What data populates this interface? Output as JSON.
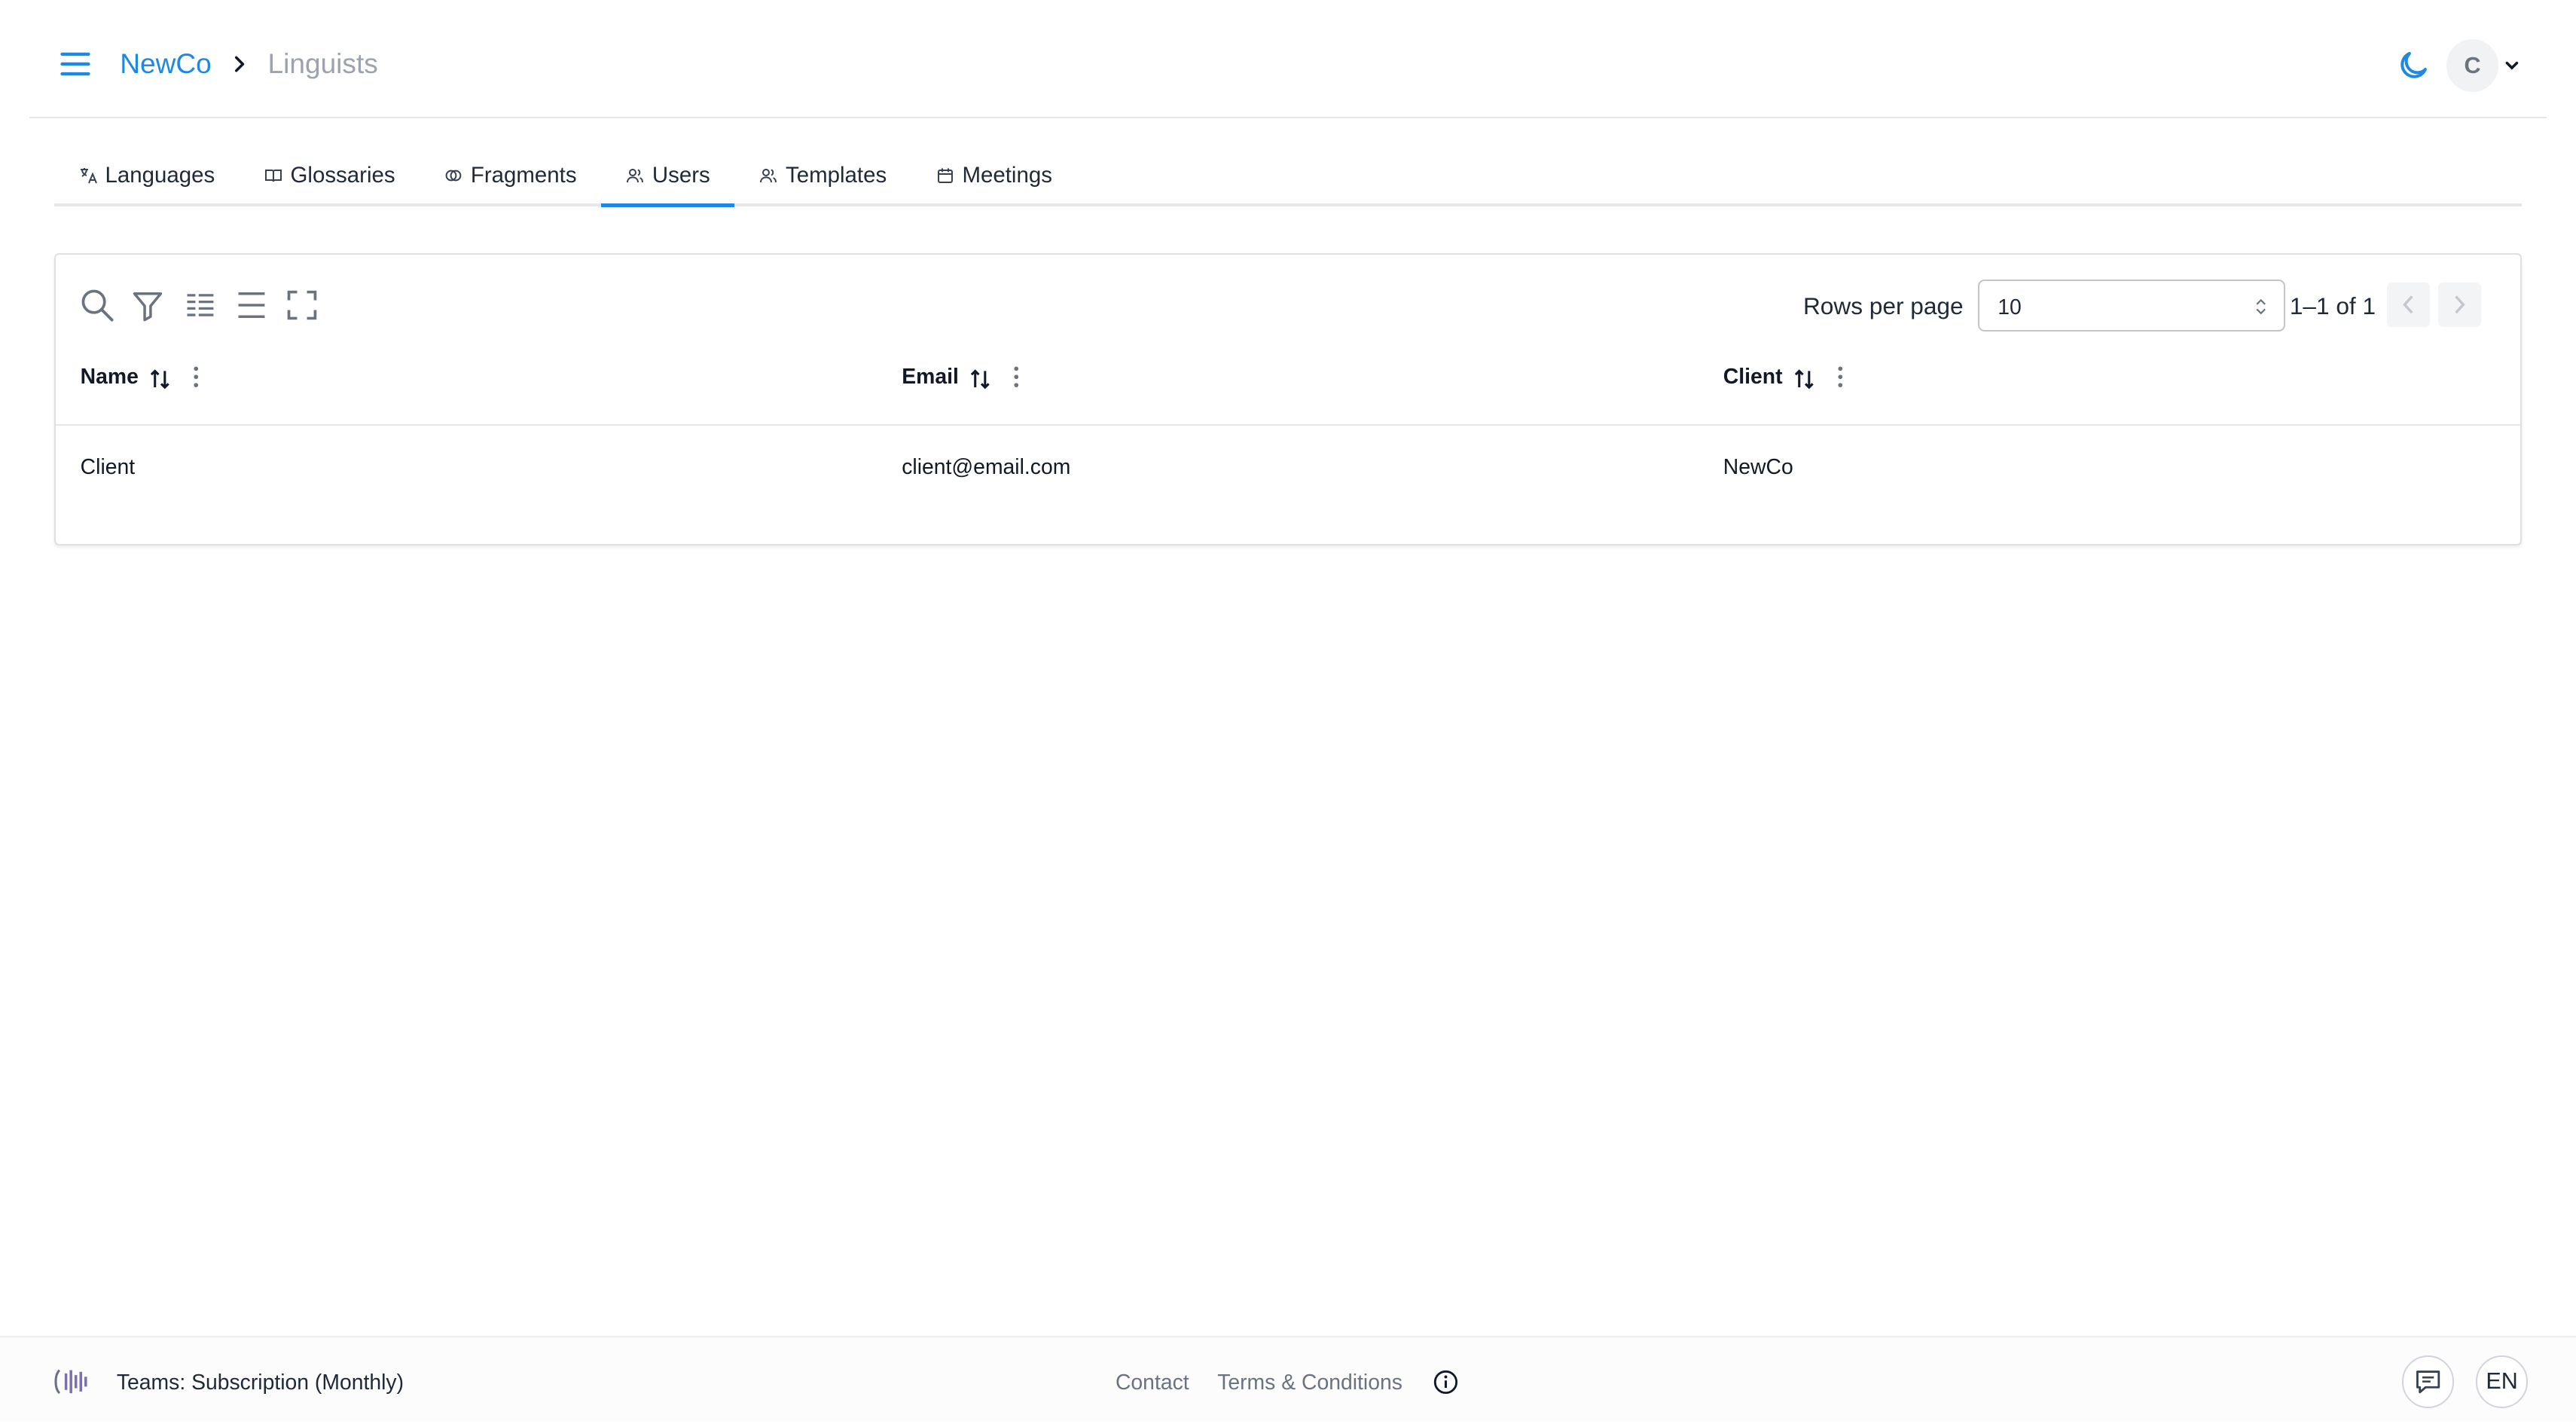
{
  "header": {
    "breadcrumb_home": "NewCo",
    "breadcrumb_current": "Linguists",
    "avatar_initial": "C",
    "accent_color": "#1e88e5"
  },
  "tabs": [
    {
      "label": "Languages",
      "icon": "translate-icon"
    },
    {
      "label": "Glossaries",
      "icon": "book-icon"
    },
    {
      "label": "Fragments",
      "icon": "fragments-icon"
    },
    {
      "label": "Users",
      "icon": "users-icon",
      "active": true
    },
    {
      "label": "Templates",
      "icon": "users-icon"
    },
    {
      "label": "Meetings",
      "icon": "calendar-icon"
    }
  ],
  "table": {
    "toolbar_icons": [
      "search-icon",
      "filter-icon",
      "columns-icon",
      "density-icon",
      "fullscreen-icon"
    ],
    "rows_per_page_label": "Rows per page",
    "rows_per_page_value": "10",
    "range_text": "1–1 of 1",
    "columns": [
      "Name",
      "Email",
      "Client"
    ],
    "rows": [
      {
        "name": "Client",
        "email": "client@email.com",
        "client": "NewCo"
      }
    ]
  },
  "footer": {
    "plan": "Teams: Subscription (Monthly)",
    "contact": "Contact",
    "terms": "Terms & Conditions",
    "language": "EN"
  }
}
